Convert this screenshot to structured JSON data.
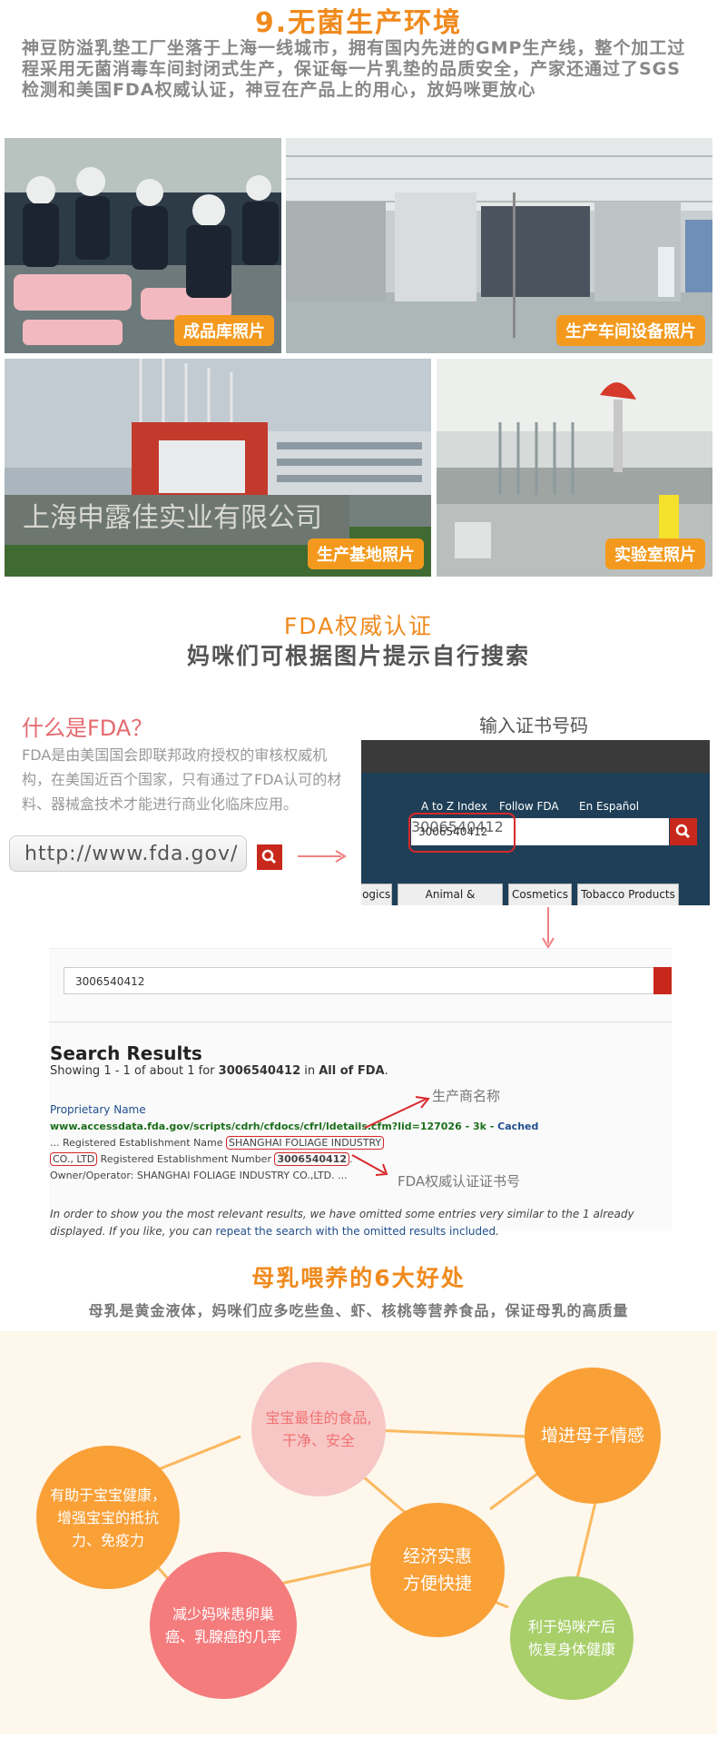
{
  "section1": {
    "title": "9.无菌生产环境",
    "description": "神豆防溢乳垫工厂坐落于上海一线城市，拥有国内先进的GMP生产线，整个加工过程采用无菌消毒车间封闭式生产，保证每一片乳垫的品质安全，产家还通过了SGS检测和美国FDA权威认证，神豆在产品上的用心，放妈咪更放心",
    "photos": [
      {
        "label": "成品库照片"
      },
      {
        "label": "生产车间设备照片"
      },
      {
        "label": "生产基地照片"
      },
      {
        "label": "实验室照片"
      }
    ],
    "sign_text": "上海申露佳实业有限公司"
  },
  "section2": {
    "title": "FDA权威认证",
    "subtitle": "妈咪们可根据图片提示自行搜索",
    "question": "什么是FDA？",
    "description": "FDA是由美国国会即联邦政府授权的审核权威机构，在美国近百个国家，只有通过了FDA认可的材料、器械盒技术才能进行商业化临床应用。",
    "url": "http://www.fda.gov/",
    "input_hint": "输入证书号码",
    "fda_site": {
      "nav": [
        "A to Z Index",
        "Follow FDA",
        "En Español"
      ],
      "search_value": "3006540412",
      "categories": [
        "logics",
        "Animal & Veterinary",
        "Cosmetics",
        "Tobacco Products"
      ]
    },
    "results": {
      "search_value": "3006540412",
      "title": "Search Results",
      "showing_prefix": "Showing 1 - 1 of about 1 for ",
      "showing_query": "3006540412",
      "showing_mid": " in ",
      "showing_scope": "All of FDA",
      "showing_end": ".",
      "result_title": "Proprietary Name",
      "result_url": "www.accessdata.fda.gov/scripts/cdrh/cfdocs/cfrl/ldetails.cfm?lid=127026",
      "result_size": " - 3k - ",
      "result_cached": "Cached",
      "line1_prefix": "... Registered Establishment Name ",
      "line1_name": "SHANGHAI FOLIAGE INDUSTRY",
      "line2_name": "CO., LTD",
      "line2_mid": " Registered Establishment Number ",
      "line2_number": "3006540412",
      "line2_end": ".",
      "line3": "Owner/Operator: SHANGHAI FOLIAGE INDUSTRY CO.,LTD. ...",
      "omit_text": "In order to show you the most relevant results, we have omitted some entries very similar to the 1 already displayed. If you like, you can ",
      "omit_link": "repeat the search with the omitted results included",
      "omit_end": ".",
      "annotation_manufacturer": "生产商名称",
      "annotation_cert": "FDA权威认证证书号"
    }
  },
  "section3": {
    "title": "母乳喂养的6大好处",
    "subtitle": "母乳是黄金液体，妈咪们应多吃些鱼、虾、核桃等营养食品，保证母乳的高质量",
    "benefits": [
      "有助于宝宝健康，增强宝宝的抵抗力、免疫力",
      "宝宝最佳的食品,干净、安全",
      "增进母子情感",
      "经济实惠方便快捷",
      "减少妈咪患卵巢癌、乳腺癌的几率",
      "利于妈咪产后恢复身体健康"
    ],
    "colors": {
      "orange": "#f9a037",
      "pink": "#f7c7c6",
      "rose": "#f47c7d",
      "green": "#a8cf6a",
      "line": "#fbb85e"
    }
  },
  "colors": {
    "accent": "#f08a1d",
    "tag": "#f39a1e",
    "red": "#c8281c",
    "fda_navy": "#1e3f57"
  }
}
